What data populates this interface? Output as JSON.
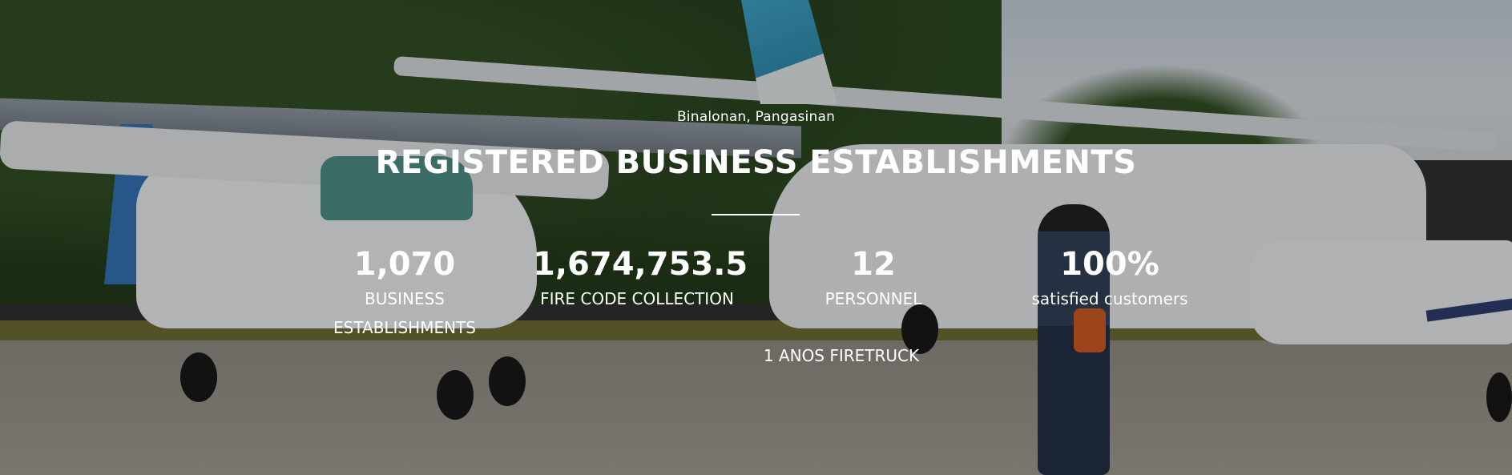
{
  "hero": {
    "location": "Binalonan, Pangasinan",
    "title": "REGISTERED BUSINESS ESTABLISHMENTS",
    "stats": [
      {
        "number": "1,070",
        "label": "BUSINESS ESTABLISHMENTS"
      },
      {
        "number": "1,674,753.5",
        "label": "FIRE CODE COLLECTION"
      },
      {
        "number": "12",
        "label": "PERSONNEL"
      },
      {
        "number": "100%",
        "label": "satisfied customers"
      }
    ],
    "extra_label": "1 ANOS FIRETRUCK"
  },
  "colors": {
    "text": "#ffffff",
    "overlay": "rgba(20,20,20,0.28)"
  }
}
